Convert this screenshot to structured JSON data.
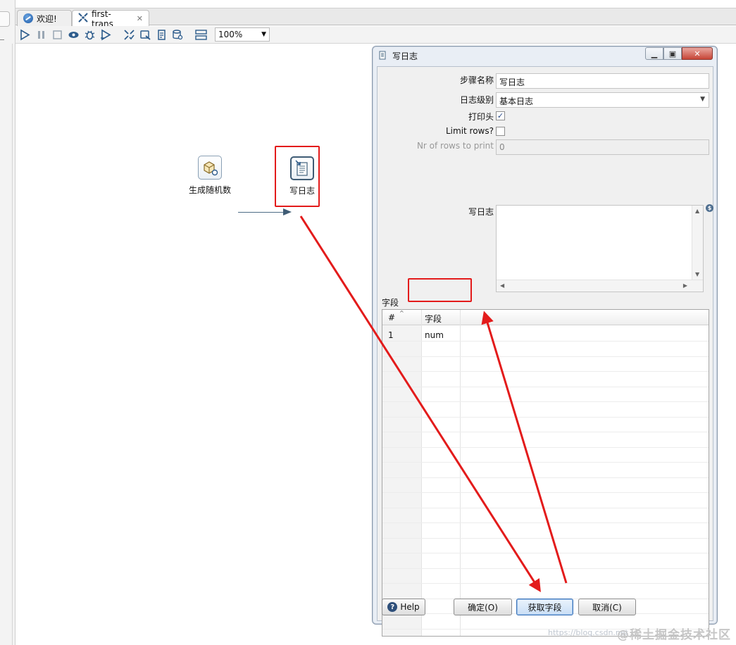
{
  "tabs": [
    {
      "label": "欢迎!",
      "icon": "globe-icon",
      "closable": false
    },
    {
      "label": "first-trans",
      "icon": "transformation-icon",
      "closable": true
    }
  ],
  "toolbar": {
    "buttons": [
      "run",
      "pause",
      "stop",
      "preview",
      "debug",
      "replay",
      "verify",
      "impact",
      "sql",
      "explore-db",
      "show-results"
    ],
    "zoom": "100%"
  },
  "canvas": {
    "steps": [
      {
        "label": "生成随机数",
        "icon": "random-generator-icon"
      },
      {
        "label": "写日志",
        "icon": "write-log-icon"
      }
    ]
  },
  "dialog": {
    "title": "写日志",
    "fields": {
      "step_name_label": "步骤名称",
      "step_name_value": "写日志",
      "log_level_label": "日志级别",
      "log_level_value": "基本日志",
      "print_header_label": "打印头",
      "print_header_checked": true,
      "limit_rows_label": "Limit rows?",
      "limit_rows_checked": false,
      "nr_rows_label": "Nr of rows to print",
      "nr_rows_value": "0",
      "log_message_label": "写日志",
      "log_message_value": ""
    },
    "table": {
      "section_label": "字段",
      "headers": [
        "#",
        "字段"
      ],
      "rows": [
        {
          "index": "1",
          "field": "num"
        }
      ]
    },
    "buttons": {
      "help": "Help",
      "ok": "确定(O)",
      "get_fields": "获取字段",
      "cancel": "取消(C)"
    }
  },
  "watermark": {
    "url": "https://blog.csdn.net",
    "brand": "@稀土掘金技术社区"
  },
  "colors": {
    "annotation_red": "#e31b1b",
    "hop": "#3f5c75",
    "dialog_frame": "#e9eef5"
  }
}
